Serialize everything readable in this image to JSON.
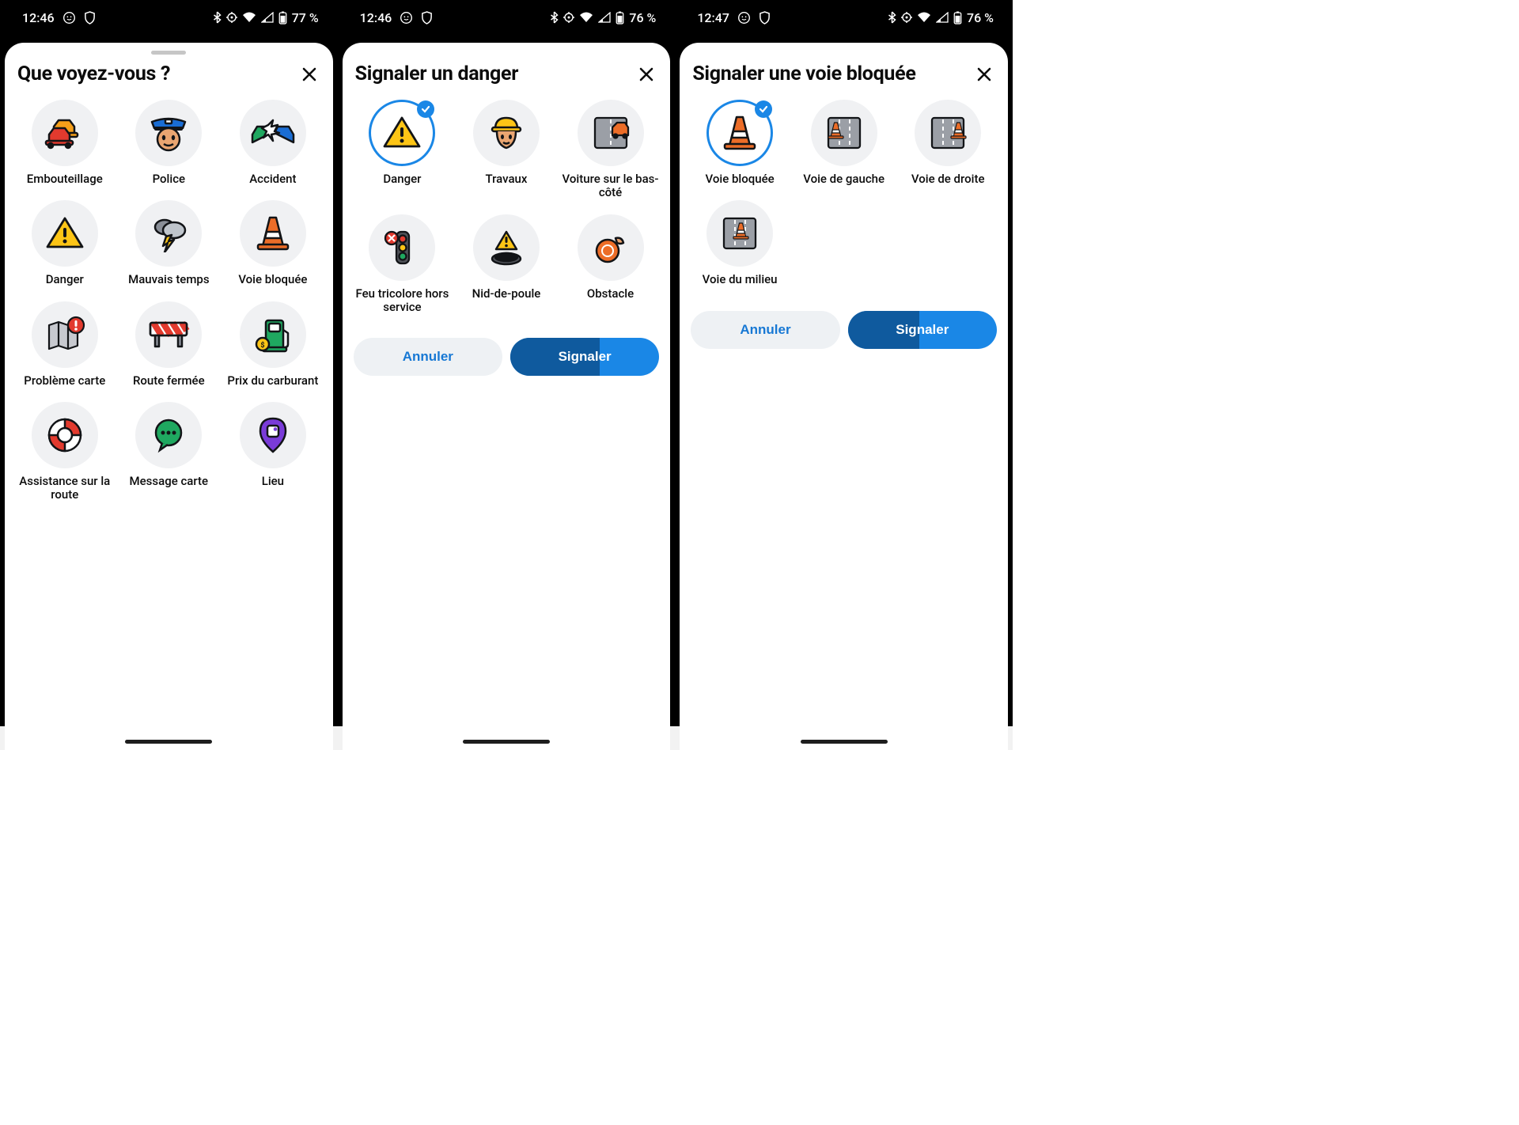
{
  "screens": [
    {
      "status": {
        "time": "12:46",
        "battery": "77 %"
      },
      "title": "Que voyez-vous ?",
      "show_handle": true,
      "items": [
        {
          "id": "traffic",
          "label": "Embouteillage",
          "icon": "traffic"
        },
        {
          "id": "police",
          "label": "Police",
          "icon": "police"
        },
        {
          "id": "accident",
          "label": "Accident",
          "icon": "accident"
        },
        {
          "id": "danger",
          "label": "Danger",
          "icon": "danger"
        },
        {
          "id": "weather",
          "label": "Mauvais temps",
          "icon": "weather"
        },
        {
          "id": "lane",
          "label": "Voie bloquée",
          "icon": "cone"
        },
        {
          "id": "maperr",
          "label": "Problème carte",
          "icon": "maperr"
        },
        {
          "id": "closed",
          "label": "Route fermée",
          "icon": "barrier"
        },
        {
          "id": "fuel",
          "label": "Prix du carburant",
          "icon": "fuel"
        },
        {
          "id": "assist",
          "label": "Assistance sur la route",
          "icon": "assist"
        },
        {
          "id": "msg",
          "label": "Message carte",
          "icon": "msg"
        },
        {
          "id": "place",
          "label": "Lieu",
          "icon": "place"
        }
      ],
      "buttons": null
    },
    {
      "status": {
        "time": "12:46",
        "battery": "76 %"
      },
      "title": "Signaler un danger",
      "show_handle": false,
      "items": [
        {
          "id": "danger",
          "label": "Danger",
          "icon": "danger",
          "selected": true
        },
        {
          "id": "roadwork",
          "label": "Travaux",
          "icon": "worker"
        },
        {
          "id": "shoulder",
          "label": "Voiture sur le bas-côté",
          "icon": "shoulder"
        },
        {
          "id": "light",
          "label": "Feu tricolore hors service",
          "icon": "trafficlight"
        },
        {
          "id": "pothole",
          "label": "Nid-de-poule",
          "icon": "pothole"
        },
        {
          "id": "obstacle",
          "label": "Obstacle",
          "icon": "obstacle"
        }
      ],
      "buttons": {
        "cancel": "Annuler",
        "report": "Signaler",
        "progress": 0.6
      }
    },
    {
      "status": {
        "time": "12:47",
        "battery": "76 %"
      },
      "title": "Signaler une voie bloquée",
      "show_handle": false,
      "items": [
        {
          "id": "blocked",
          "label": "Voie bloquée",
          "icon": "cone",
          "selected": true
        },
        {
          "id": "left",
          "label": "Voie de gauche",
          "icon": "lane-left"
        },
        {
          "id": "right",
          "label": "Voie de droite",
          "icon": "lane-right"
        },
        {
          "id": "middle",
          "label": "Voie du milieu",
          "icon": "lane-mid"
        }
      ],
      "buttons": {
        "cancel": "Annuler",
        "report": "Signaler",
        "progress": 0.48
      }
    }
  ]
}
